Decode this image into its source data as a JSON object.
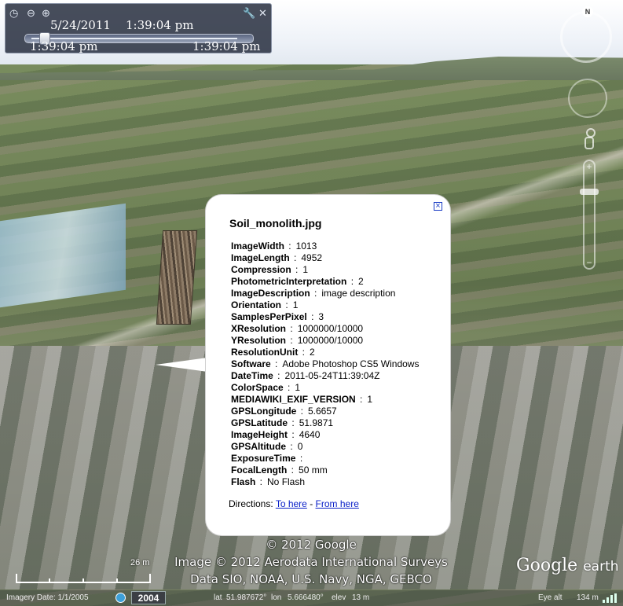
{
  "time_slider": {
    "date": "5/24/2011",
    "time": "1:39:04 pm",
    "start_label": "1:39:04 pm",
    "end_label": "1:39:04 pm"
  },
  "navigation": {
    "north_label": "N"
  },
  "balloon": {
    "title": "Soil_monolith.jpg",
    "properties": [
      {
        "key": "ImageWidth",
        "value": "1013"
      },
      {
        "key": "ImageLength",
        "value": "4952"
      },
      {
        "key": "Compression",
        "value": "1"
      },
      {
        "key": "PhotometricInterpretation",
        "value": "2"
      },
      {
        "key": "ImageDescription",
        "value": "image description"
      },
      {
        "key": "Orientation",
        "value": "1"
      },
      {
        "key": "SamplesPerPixel",
        "value": "3"
      },
      {
        "key": "XResolution",
        "value": "1000000/10000"
      },
      {
        "key": "YResolution",
        "value": "1000000/10000"
      },
      {
        "key": "ResolutionUnit",
        "value": "2"
      },
      {
        "key": "Software",
        "value": "Adobe Photoshop CS5 Windows"
      },
      {
        "key": "DateTime",
        "value": "2011-05-24T11:39:04Z"
      },
      {
        "key": "ColorSpace",
        "value": "1"
      },
      {
        "key": "MEDIAWIKI_EXIF_VERSION",
        "value": "1"
      },
      {
        "key": "GPSLongitude",
        "value": "5.6657"
      },
      {
        "key": "GPSLatitude",
        "value": "51.9871"
      },
      {
        "key": "ImageHeight",
        "value": "4640"
      },
      {
        "key": "GPSAltitude",
        "value": "0"
      },
      {
        "key": "ExposureTime",
        "value": ""
      },
      {
        "key": "FocalLength",
        "value": "50 mm"
      },
      {
        "key": "Flash",
        "value": "No Flash"
      }
    ],
    "directions_label": "Directions:",
    "to_here": "To here",
    "separator": "-",
    "from_here": "From here"
  },
  "copyright": {
    "line1": "© 2012 Google",
    "line2": "Image © 2012 Aerodata International Surveys",
    "line3": "Data SIO, NOAA, U.S. Navy, NGA, GEBCO"
  },
  "scale": {
    "label": "26 m"
  },
  "logo": {
    "google": "Google",
    "earth": "earth"
  },
  "status": {
    "imagery_date": "Imagery Date: 1/1/2005",
    "year": "2004",
    "lat_label": "lat",
    "lat": "51.987672°",
    "lon_label": "lon",
    "lon": "5.666480°",
    "elev_label": "elev",
    "elev": "13 m",
    "eye_alt_label": "Eye alt",
    "eye_alt": "134 m"
  },
  "colors": {
    "panel_bg": "#1e2637",
    "link": "#0a20c8",
    "status_bg": "#464e46"
  }
}
